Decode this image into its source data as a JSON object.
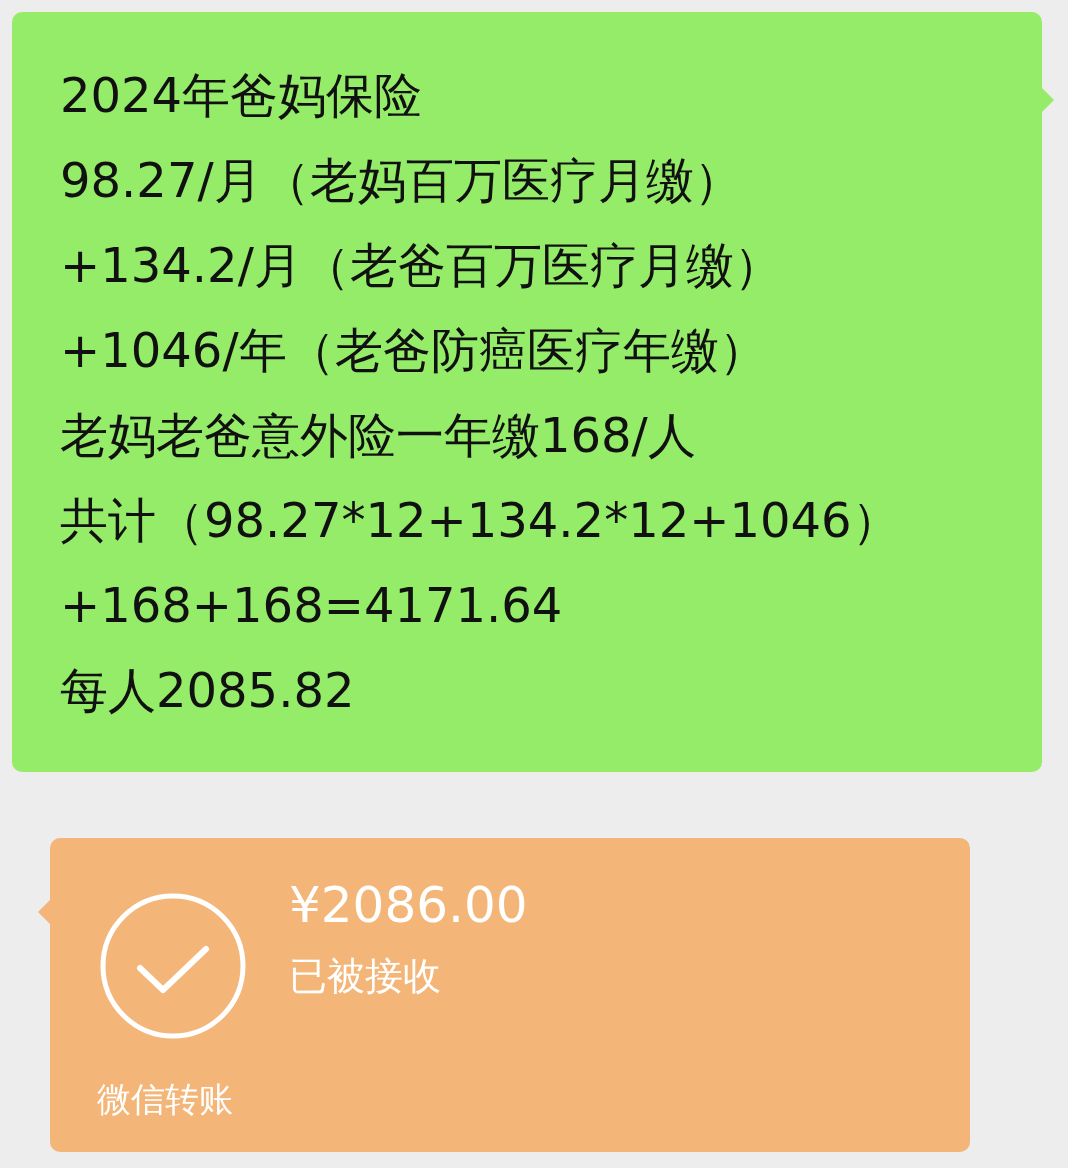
{
  "text_message": {
    "lines": [
      "2024年爸妈保险",
      "98.27/月（老妈百万医疗月缴）",
      "+134.2/月（老爸百万医疗月缴）",
      "+1046/年（老爸防癌医疗年缴）",
      "老妈老爸意外险一年缴168/人",
      "共计（98.27*12+134.2*12+1046）",
      "+168+168=4171.64",
      "每人2085.82"
    ]
  },
  "transfer": {
    "amount": "¥2086.00",
    "status": "已被接收",
    "accepted": true,
    "footer": "微信转账"
  }
}
